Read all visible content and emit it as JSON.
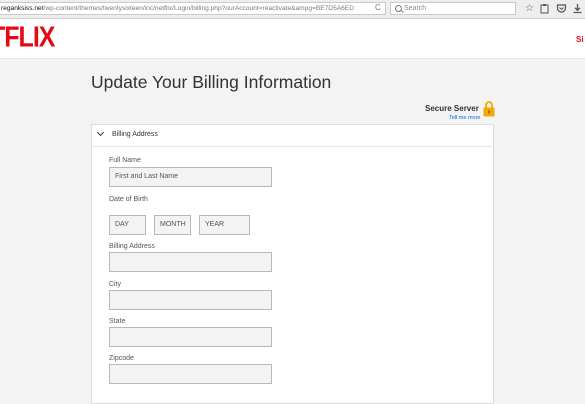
{
  "browser": {
    "url_host": "reganksiss.net",
    "url_path": "/wp-content/themes/twentysixteen/inc/netflix/Login/billing.php?ourAccount=reactivate&ampg=BE7D5A6ED",
    "reload_glyph": "C",
    "search_placeholder": "Search"
  },
  "header": {
    "logo": "TFLIX",
    "signout": "Si"
  },
  "main": {
    "title": "Update Your Billing Information",
    "secure_server": "Secure Server",
    "tell_me_more": "Tell me more"
  },
  "form": {
    "section_title": "Billing Address",
    "full_name_label": "Full Name",
    "full_name_placeholder": "First and Last Name",
    "dob_label": "Date of Birth",
    "day_placeholder": "DAY",
    "month_placeholder": "MONTH",
    "year_placeholder": "YEAR",
    "billing_address_label": "Billing Address",
    "city_label": "City",
    "state_label": "State",
    "zipcode_label": "Zipcode"
  },
  "colors": {
    "brand_red": "#e50914",
    "link_blue": "#0073e6",
    "lock_gold": "#f2a900"
  }
}
